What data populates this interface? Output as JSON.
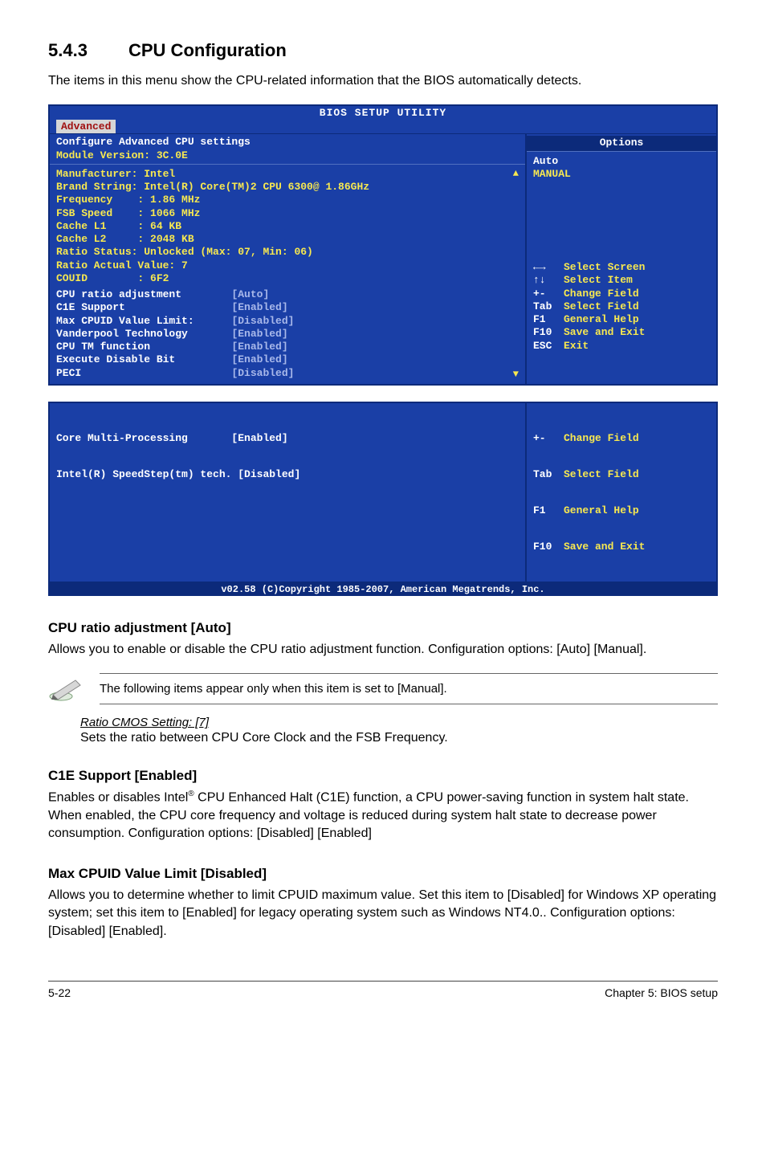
{
  "section": {
    "number": "5.4.3",
    "title": "CPU Configuration"
  },
  "intro": "The items in this menu show the CPU-related information that the BIOS automatically detects.",
  "bios": {
    "title": "BIOS SETUP UTILITY",
    "tab": "Advanced",
    "conf_line1": "Configure Advanced CPU settings",
    "conf_line2": " Module Version: 3C.0E",
    "info": [
      "Manufacturer: Intel",
      "Brand String: Intel(R) Core(TM)2 CPU 6300@ 1.86GHz",
      "Frequency    : 1.86 MHz",
      "FSB Speed    : 1066 MHz",
      "Cache L1     : 64 KB",
      "Cache L2     : 2048 KB",
      "Ratio Status: Unlocked (Max: 07, Min: 06)",
      "Ratio Actual Value: 7",
      "COUID        : 6F2"
    ],
    "settings": [
      {
        "label": "CPU ratio adjustment        ",
        "value": "[Auto]"
      },
      {
        "label": "C1E Support                 ",
        "value": "[Enabled]"
      },
      {
        "label": "Max CPUID Value Limit:      ",
        "value": "[Disabled]"
      },
      {
        "label": "Vanderpool Technology       ",
        "value": "[Enabled]"
      },
      {
        "label": "CPU TM function             ",
        "value": "[Enabled]"
      },
      {
        "label": "Execute Disable Bit         ",
        "value": "[Enabled]"
      },
      {
        "label": "PECI                        ",
        "value": "[Disabled]"
      }
    ],
    "right": {
      "options_header": "Options",
      "auto": "Auto",
      "manual": "MANUAL",
      "nav": [
        {
          "key": "←→",
          "txt": "Select Screen"
        },
        {
          "key": "↑↓",
          "txt": "Select Item"
        },
        {
          "key": "+-",
          "txt": "Change Field"
        },
        {
          "key": "Tab",
          "txt": "Select Field"
        },
        {
          "key": "F1",
          "txt": "General Help"
        },
        {
          "key": "F10",
          "txt": "Save and Exit"
        },
        {
          "key": "ESC",
          "txt": "Exit"
        }
      ]
    }
  },
  "bios2": {
    "left": [
      "Core Multi-Processing       [Enabled]",
      "Intel(R) SpeedStep(tm) tech. [Disabled]"
    ],
    "right": [
      {
        "key": "+-",
        "txt": "Change Field"
      },
      {
        "key": "Tab",
        "txt": "Select Field"
      },
      {
        "key": "F1",
        "txt": "General Help"
      },
      {
        "key": "F10",
        "txt": "Save and Exit"
      }
    ]
  },
  "copyright": "v02.58 (C)Copyright 1985-2007, American Megatrends, Inc.",
  "sub1": {
    "heading": "CPU ratio adjustment [Auto]",
    "p": "Allows you to enable or disable the CPU ratio adjustment function. Configuration options: [Auto] [Manual].",
    "note": "The following items appear only when this item is set to [Manual].",
    "ratio_label": "Ratio CMOS Setting: [7]",
    "ratio_desc": "Sets the ratio between CPU Core Clock and the FSB Frequency."
  },
  "sub2": {
    "heading": "C1E Support [Enabled]",
    "p1a": "Enables or disables Intel",
    "p1b": " CPU Enhanced Halt (C1E) function, a CPU power-saving function in system halt state. When enabled, the CPU core frequency and voltage is reduced during system halt state to decrease power consumption. Configuration options: [Disabled] [Enabled]"
  },
  "sub3": {
    "heading": "Max CPUID Value Limit [Disabled]",
    "p": "Allows you to determine whether to limit CPUID maximum value. Set this item to [Disabled] for Windows XP operating system; set this item to [Enabled] for legacy operating system such as Windows  NT4.0.. Configuration options: [Disabled] [Enabled]."
  },
  "footer": {
    "left": "5-22",
    "right": "Chapter 5: BIOS setup"
  }
}
